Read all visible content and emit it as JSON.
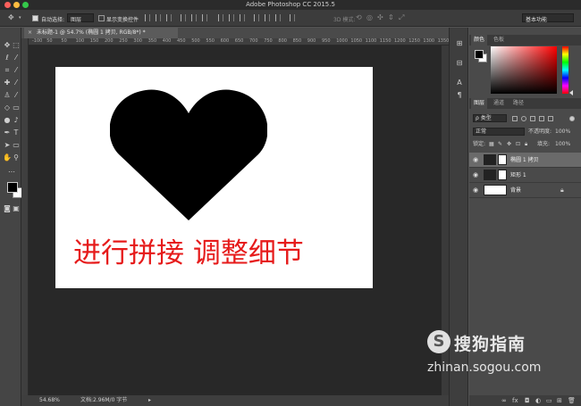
{
  "window": {
    "title": "Adobe Photoshop CC 2015.5",
    "traffic_colors": [
      "#fc605c",
      "#fdbc40",
      "#34c84a"
    ]
  },
  "options_bar": {
    "move_icon": "move-icon",
    "auto_select_label": "自动选择:",
    "auto_select_value": "图层",
    "show_transform_label": "显示变换控件",
    "mode_3d_label": "3D 模式:",
    "workspace": "基本功能"
  },
  "document": {
    "tab_title": "未标题-1 @ 54.7% (椭圆 1 拷贝, RGB/8*) *",
    "ruler_ticks": [
      "-100",
      "50",
      "50",
      "100",
      "150",
      "200",
      "250",
      "300",
      "350",
      "400",
      "450",
      "500",
      "550",
      "600",
      "650",
      "700",
      "750",
      "800",
      "850",
      "900",
      "950",
      "1000",
      "1050",
      "1100",
      "1150",
      "1200",
      "1250",
      "1300",
      "1350"
    ],
    "canvas_text": "进行拼接 调整细节",
    "canvas_text_color": "#e61b1b",
    "shape_color": "#000000"
  },
  "status_bar": {
    "zoom": "54.68%",
    "doc_info": "文档:2.96M/0 字节"
  },
  "color_panel": {
    "tabs": [
      "颜色",
      "色板"
    ],
    "foreground": "#000000",
    "background": "#ffffff",
    "hue_color": "#ff0000"
  },
  "layers_panel": {
    "tabs": [
      "图层",
      "通道",
      "路径"
    ],
    "filter_label": "ρ 类型",
    "blend_mode": "正常",
    "opacity_label": "不透明度:",
    "opacity_value": "100%",
    "lock_label": "锁定:",
    "fill_label": "填充:",
    "fill_value": "100%",
    "layers": [
      {
        "name": "椭圆 1 拷贝",
        "selected": true,
        "locked": false
      },
      {
        "name": "矩形 1",
        "selected": false,
        "locked": false
      },
      {
        "name": "背景",
        "selected": false,
        "locked": true
      }
    ],
    "footer_icons": [
      "link-icon",
      "fx-icon",
      "mask-icon",
      "adjustment-icon",
      "folder-icon",
      "new-layer-icon",
      "trash-icon"
    ]
  },
  "watermark": {
    "brand": "搜狗指南",
    "url": "zhinan.sogou.com"
  }
}
